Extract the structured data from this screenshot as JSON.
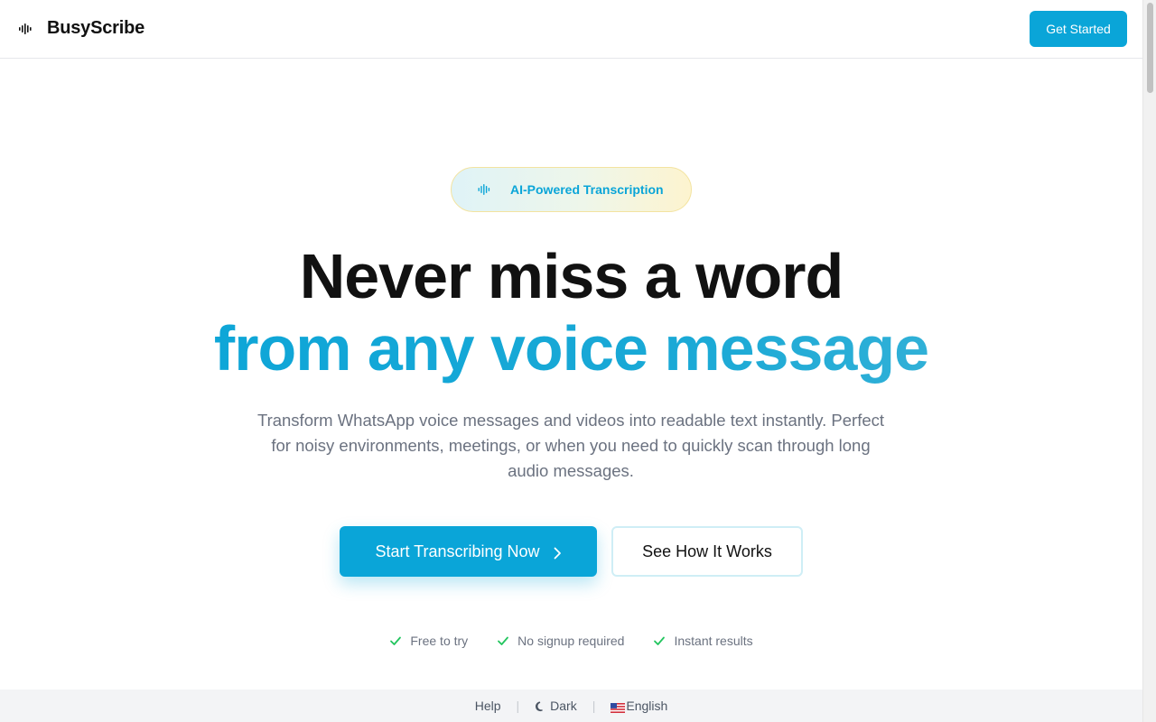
{
  "header": {
    "logo_text": "BusyScribe",
    "logo_icon": "soundwave-icon",
    "cta_label": "Get Started"
  },
  "hero": {
    "badge_icon": "soundwave-icon",
    "badge_text": "AI-Powered Transcription",
    "headline_line1": "Never miss a word",
    "headline_line2": "from any voice message",
    "subtitle": "Transform WhatsApp voice messages and videos into readable text instantly. Perfect for noisy environments, meetings, or when you need to quickly scan through long audio messages.",
    "primary_button": "Start Transcribing Now",
    "secondary_button": "See How It Works",
    "features": [
      {
        "label": "Free to try",
        "icon": "check-icon"
      },
      {
        "label": "No signup required",
        "icon": "check-icon"
      },
      {
        "label": "Instant results",
        "icon": "check-icon"
      }
    ]
  },
  "footer": {
    "help": "Help",
    "theme": "Dark",
    "theme_icon": "moon-icon",
    "language": "English",
    "language_icon": "us-flag-icon"
  },
  "colors": {
    "accent": "#0aa5d8",
    "check": "#22c55e",
    "text_muted": "#6b7280"
  }
}
